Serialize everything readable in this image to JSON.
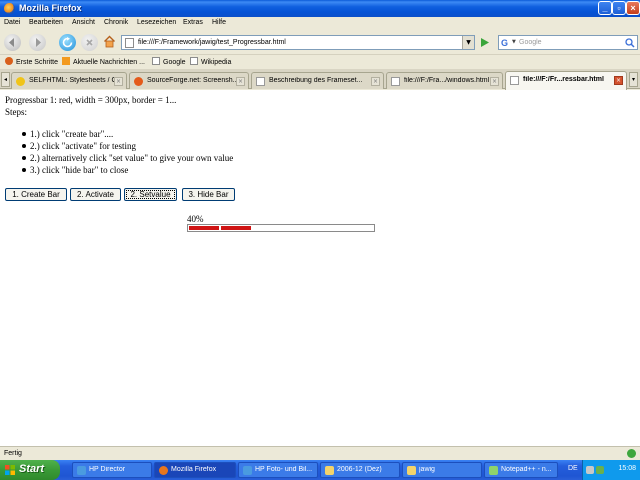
{
  "window": {
    "title": "Mozilla Firefox"
  },
  "menu": [
    "Datei",
    "Bearbeiten",
    "Ansicht",
    "Chronik",
    "Lesezeichen",
    "Extras",
    "Hilfe"
  ],
  "nav": {
    "url": "file:///F:/Framework/jawig/test_Progressbar.html",
    "search_engine": "G",
    "search_placeholder": "Google"
  },
  "bookmarks": [
    "Erste Schritte",
    "Aktuelle Nachrichten ...",
    "Google",
    "Wikipedia"
  ],
  "tabs": [
    {
      "label": "SELFHTML: Stylesheets / C..."
    },
    {
      "label": "SourceForge.net: Screensh..."
    },
    {
      "label": "Beschreibung des Frameset..."
    },
    {
      "label": "file:///F:/Fra.../windows.html"
    },
    {
      "label": "file:///F:/Fr...ressbar.html"
    }
  ],
  "content": {
    "line1": "Progressbar 1: red, width = 300px, border = 1...",
    "line2": "Steps:",
    "steps": [
      "1.) click \"create bar\"....",
      "2.) click \"activate\" for testing",
      "2.) alternatively click \"set value\" to give your own value",
      "3.) click \"hide bar\" to close"
    ],
    "buttons": {
      "create": "1. Create Bar",
      "activate": "2. Activate",
      "setvalue": "2. Setvalue",
      "hide": "3. Hide Bar"
    },
    "progress": {
      "percent_label": "40%",
      "value": 0.34,
      "color": "#d01414"
    }
  },
  "status": {
    "text": "Fertig"
  },
  "taskbar": {
    "start": "Start",
    "tasks": [
      "HP Director",
      "Mozilla Firefox",
      "HP Foto- und Bil...",
      "2006-12 (Dez)",
      "jawig",
      "Notepad++ - n..."
    ],
    "lang": "DE",
    "clock": "15:08"
  }
}
